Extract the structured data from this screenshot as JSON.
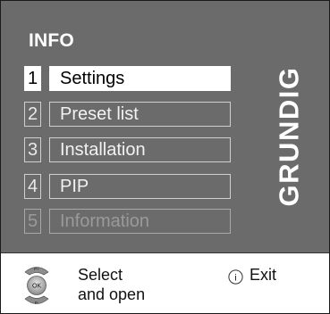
{
  "menu": {
    "title": "INFO",
    "brand": "GRUNDIG",
    "items": [
      {
        "number": "1",
        "label": "Settings",
        "state": "selected"
      },
      {
        "number": "2",
        "label": "Preset list",
        "state": "normal"
      },
      {
        "number": "3",
        "label": "Installation",
        "state": "normal"
      },
      {
        "number": "4",
        "label": "PIP",
        "state": "normal"
      },
      {
        "number": "5",
        "label": "Information",
        "state": "disabled"
      }
    ]
  },
  "footer": {
    "ok_cluster": {
      "up_label": "P+",
      "center_label": "OK",
      "down_label": "P-",
      "icon": "ok-rocker-icon"
    },
    "select_hint_line1": "Select",
    "select_hint_line2": "and open",
    "info_button_glyph": "i",
    "exit_hint": "Exit"
  },
  "colors": {
    "panel": "#6b6b6b",
    "selected_bg": "#ffffff",
    "disabled_text": "#9a9a9a"
  }
}
